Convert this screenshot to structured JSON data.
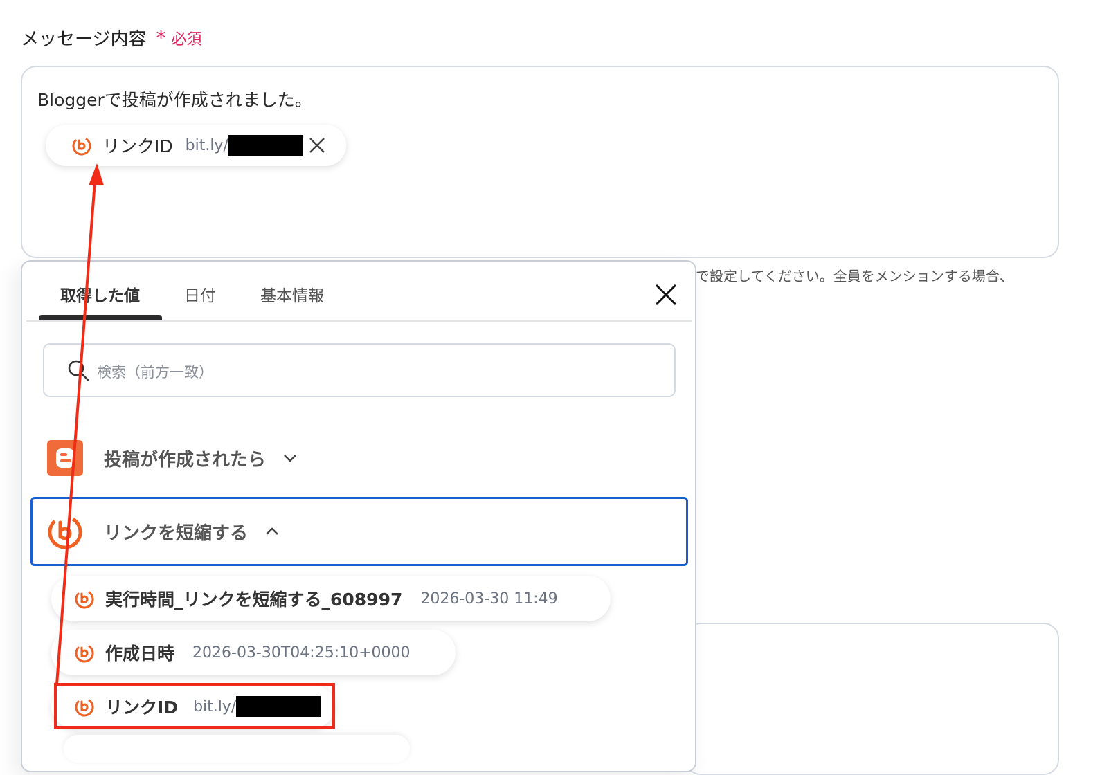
{
  "field": {
    "label": "メッセージ内容",
    "required_star": "*",
    "required_text": "必須"
  },
  "message": {
    "text": "Bloggerで投稿が作成されました。",
    "inserted_pill": {
      "label": "リンクID",
      "value": "bit.ly/"
    }
  },
  "hint": {
    "text": "で設定してください。全員をメンションする場合、"
  },
  "panel": {
    "tabs": [
      {
        "label": "取得した値",
        "active": true
      },
      {
        "label": "日付",
        "active": false
      },
      {
        "label": "基本情報",
        "active": false
      }
    ],
    "search_placeholder": "検索（前方一致）",
    "groups": [
      {
        "title": "投稿が作成されたら",
        "expanded": false,
        "icon": "blogger-icon"
      },
      {
        "title": "リンクを短縮する",
        "expanded": true,
        "icon": "bitly-icon"
      }
    ],
    "items": [
      {
        "label": "実行時間_リンクを短縮する_608997",
        "value": "2026-03-30 11:49"
      },
      {
        "label": "作成日時",
        "value": "2026-03-30T04:25:10+0000"
      },
      {
        "label": "リンクID",
        "value": "bit.ly/"
      }
    ]
  },
  "colors": {
    "accent_red": "#e0245e",
    "annotation_red": "#f02b17",
    "bitly_orange": "#ee6123",
    "blogger_orange": "#ef6c3a",
    "focus_blue": "#1a5fd0"
  }
}
